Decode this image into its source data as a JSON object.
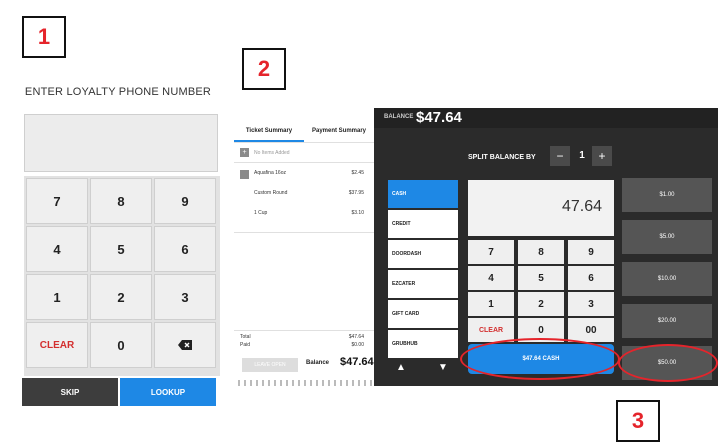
{
  "badges": [
    "1",
    "2",
    "3"
  ],
  "loyalty": {
    "title": "ENTER LOYALTY PHONE NUMBER",
    "keys": [
      "7",
      "8",
      "9",
      "4",
      "5",
      "6",
      "1",
      "2",
      "3",
      "CLEAR",
      "0"
    ],
    "backspace_icon": "backspace-icon",
    "skip": "SKIP",
    "lookup": "LOOKUP"
  },
  "ticket": {
    "tabs": [
      "Ticket Summary",
      "Payment Summary"
    ],
    "no_items": "No Items Added",
    "items": [
      {
        "name": "Aquafina 16oz",
        "price": "$2.45"
      },
      {
        "name": "Custom Round",
        "price": "$37.95"
      },
      {
        "name": "1 Cup",
        "price": "$3.10"
      }
    ],
    "total_label": "Total",
    "total_value": "$47.64",
    "paid_label": "Paid",
    "paid_value": "$0.00",
    "leave_open": "LEAVE OPEN",
    "balance_label": "Balance",
    "balance_value": "$47.64"
  },
  "payment": {
    "balance_label": "BALANCE",
    "balance_value": "$47.64",
    "split_label": "SPLIT BALANCE BY",
    "split_minus": "−",
    "split_value": "1",
    "split_plus": "+",
    "methods": [
      "CASH",
      "CREDIT",
      "DOORDASH",
      "EZCATER",
      "GIFT CARD",
      "GRUBHUB"
    ],
    "arrows": [
      "▲",
      "▼"
    ],
    "amount": "47.64",
    "keys": [
      "7",
      "8",
      "9",
      "4",
      "5",
      "6",
      "1",
      "2",
      "3",
      "CLEAR",
      "0",
      "00"
    ],
    "cash_button": "$47.64 CASH",
    "quick_amounts": [
      "$1.00",
      "$5.00",
      "$10.00",
      "$20.00",
      "$50.00"
    ]
  },
  "colors": {
    "accent": "#1e88e5",
    "highlight": "#e5242b"
  }
}
